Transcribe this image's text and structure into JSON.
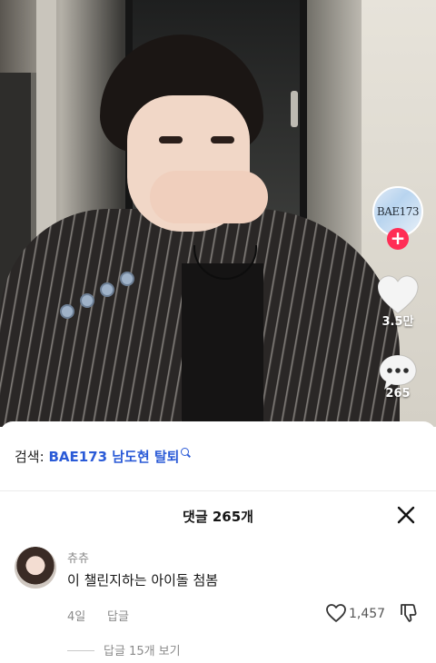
{
  "video": {
    "profile_badge": "BAE173",
    "like_count": "3.5만",
    "comment_count": "265"
  },
  "search": {
    "prefix": "검색:",
    "keyword": "BAE173 남도현 탈퇴"
  },
  "comments_panel": {
    "title": "댓글 265개",
    "comment": {
      "username": "츄츄",
      "text": "이 챌린지하는 아이돌 첨봄",
      "date": "4일",
      "reply_label": "답글",
      "like_count": "1,457",
      "view_replies": "답글 15개 보기"
    }
  },
  "colors": {
    "accent_red": "#ff2d55",
    "link_blue": "#2b5bd7"
  },
  "icons": [
    "plus-icon",
    "heart-icon",
    "comment-bubble-icon",
    "close-icon",
    "heart-outline-icon",
    "thumbs-down-icon",
    "search-icon"
  ]
}
